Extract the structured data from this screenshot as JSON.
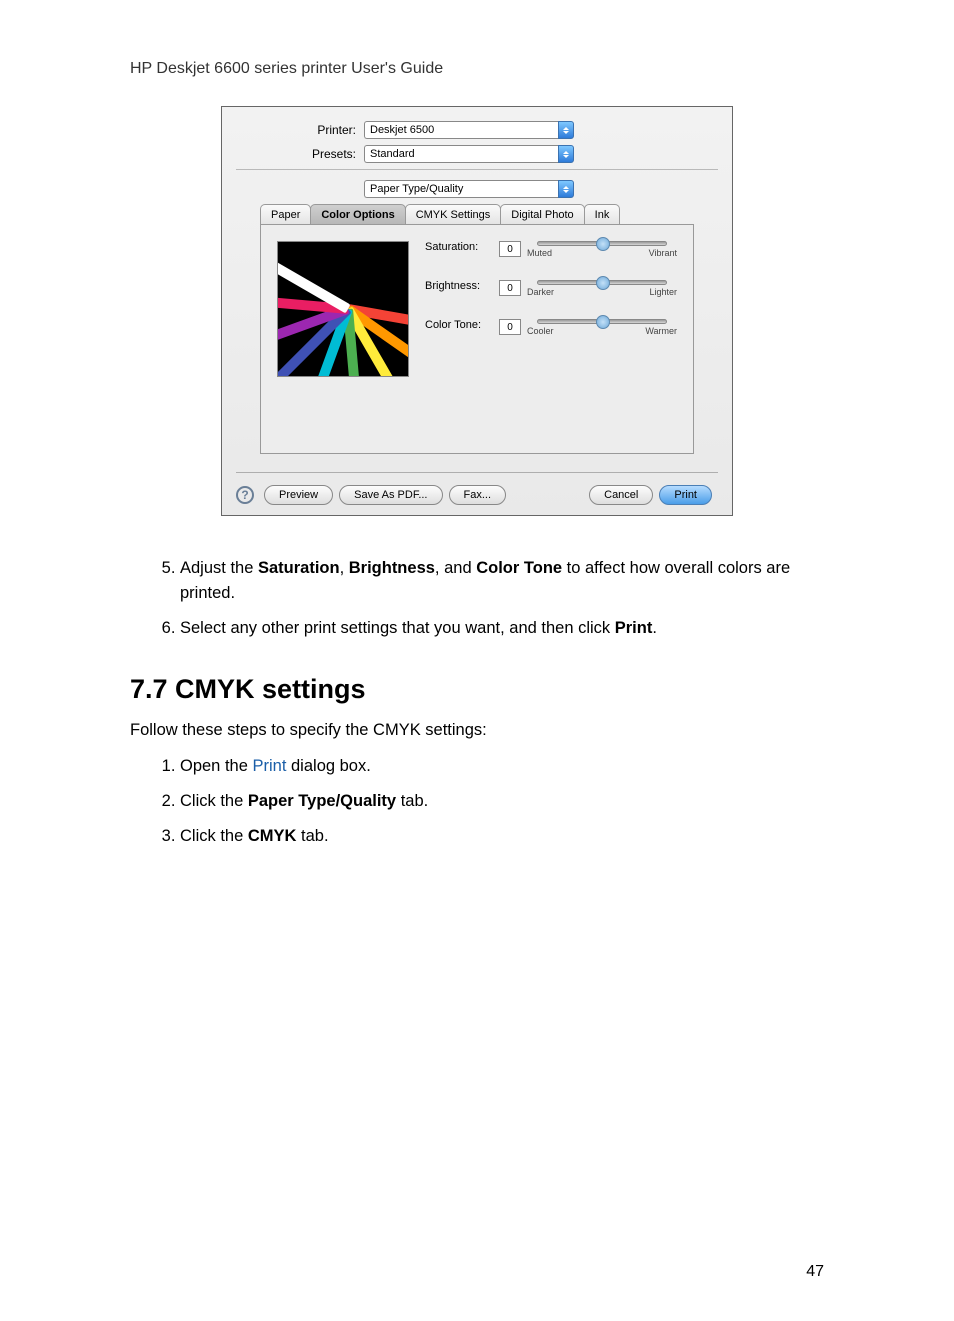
{
  "header": "HP Deskjet 6600 series printer User's Guide",
  "dialog": {
    "printer_label": "Printer:",
    "printer_value": "Deskjet 6500",
    "presets_label": "Presets:",
    "presets_value": "Standard",
    "section_value": "Paper Type/Quality",
    "tabs": {
      "paper": "Paper",
      "color_options": "Color Options",
      "cmyk": "CMYK Settings",
      "digital_photo": "Digital Photo",
      "ink": "Ink"
    },
    "sliders": {
      "saturation": {
        "label": "Saturation:",
        "value": "0",
        "low": "Muted",
        "high": "Vibrant"
      },
      "brightness": {
        "label": "Brightness:",
        "value": "0",
        "low": "Darker",
        "high": "Lighter"
      },
      "color_tone": {
        "label": "Color Tone:",
        "value": "0",
        "low": "Cooler",
        "high": "Warmer"
      }
    },
    "footer": {
      "help": "?",
      "preview": "Preview",
      "save_pdf": "Save As PDF...",
      "fax": "Fax...",
      "cancel": "Cancel",
      "print": "Print"
    }
  },
  "instructions": {
    "step5_a": "Adjust the ",
    "step5_b1": "Saturation",
    "step5_c1": ", ",
    "step5_b2": "Brightness",
    "step5_c2": ", and ",
    "step5_b3": "Color Tone",
    "step5_d": " to affect how overall colors are printed.",
    "step6_a": "Select any other print settings that you want, and then click ",
    "step6_b": "Print",
    "step6_c": "."
  },
  "section": {
    "heading": "7.7  CMYK settings",
    "intro": "Follow these steps to specify the CMYK settings:",
    "s1_a": "Open the ",
    "s1_link": "Print",
    "s1_b": " dialog box.",
    "s2_a": "Click the ",
    "s2_b": "Paper Type/Quality",
    "s2_c": " tab.",
    "s3_a": "Click the ",
    "s3_b": "CMYK",
    "s3_c": " tab."
  },
  "page_number": "47"
}
